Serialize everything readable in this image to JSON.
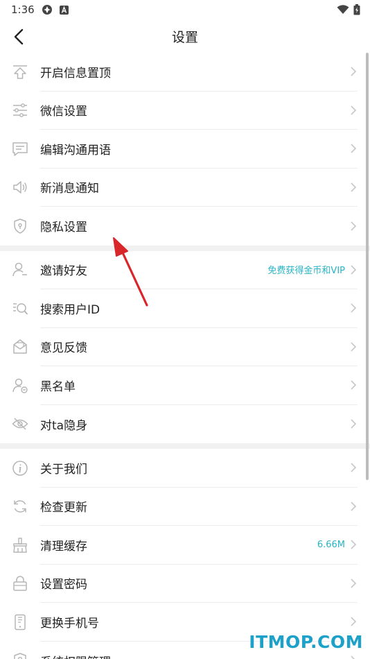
{
  "status_bar": {
    "time": "1:36"
  },
  "header": {
    "title": "设置"
  },
  "groups": [
    [
      {
        "id": "pin-messages",
        "label": "开启信息置顶",
        "icon": "pin-top-icon"
      },
      {
        "id": "wechat-settings",
        "label": "微信设置",
        "icon": "sliders-icon"
      },
      {
        "id": "edit-phrases",
        "label": "编辑沟通用语",
        "icon": "chat-bubble-icon"
      },
      {
        "id": "new-message-notify",
        "label": "新消息通知",
        "icon": "speaker-icon"
      },
      {
        "id": "privacy-settings",
        "label": "隐私设置",
        "icon": "shield-icon"
      }
    ],
    [
      {
        "id": "invite-friends",
        "label": "邀请好友",
        "icon": "user-add-icon",
        "extra": "免费获得金币和VIP"
      },
      {
        "id": "search-user-id",
        "label": "搜索用户ID",
        "icon": "search-user-icon"
      },
      {
        "id": "feedback",
        "label": "意见反馈",
        "icon": "mail-icon"
      },
      {
        "id": "blacklist",
        "label": "黑名单",
        "icon": "user-block-icon"
      },
      {
        "id": "hide-from",
        "label": "对ta隐身",
        "icon": "eye-off-icon"
      }
    ],
    [
      {
        "id": "about-us",
        "label": "关于我们",
        "icon": "info-icon"
      },
      {
        "id": "check-update",
        "label": "检查更新",
        "icon": "refresh-icon"
      },
      {
        "id": "clear-cache",
        "label": "清理缓存",
        "icon": "broom-icon",
        "extra": "6.66M"
      },
      {
        "id": "set-password",
        "label": "设置密码",
        "icon": "lock-icon"
      },
      {
        "id": "change-phone",
        "label": "更换手机号",
        "icon": "phone-icon"
      },
      {
        "id": "system-permissions",
        "label": "系统权限管理",
        "icon": "permission-icon"
      }
    ]
  ],
  "watermark": "ITMOP.COM",
  "colors": {
    "accent": "#27b4c4",
    "arrow": "#d9262b",
    "icon": "#b5b5b5"
  }
}
